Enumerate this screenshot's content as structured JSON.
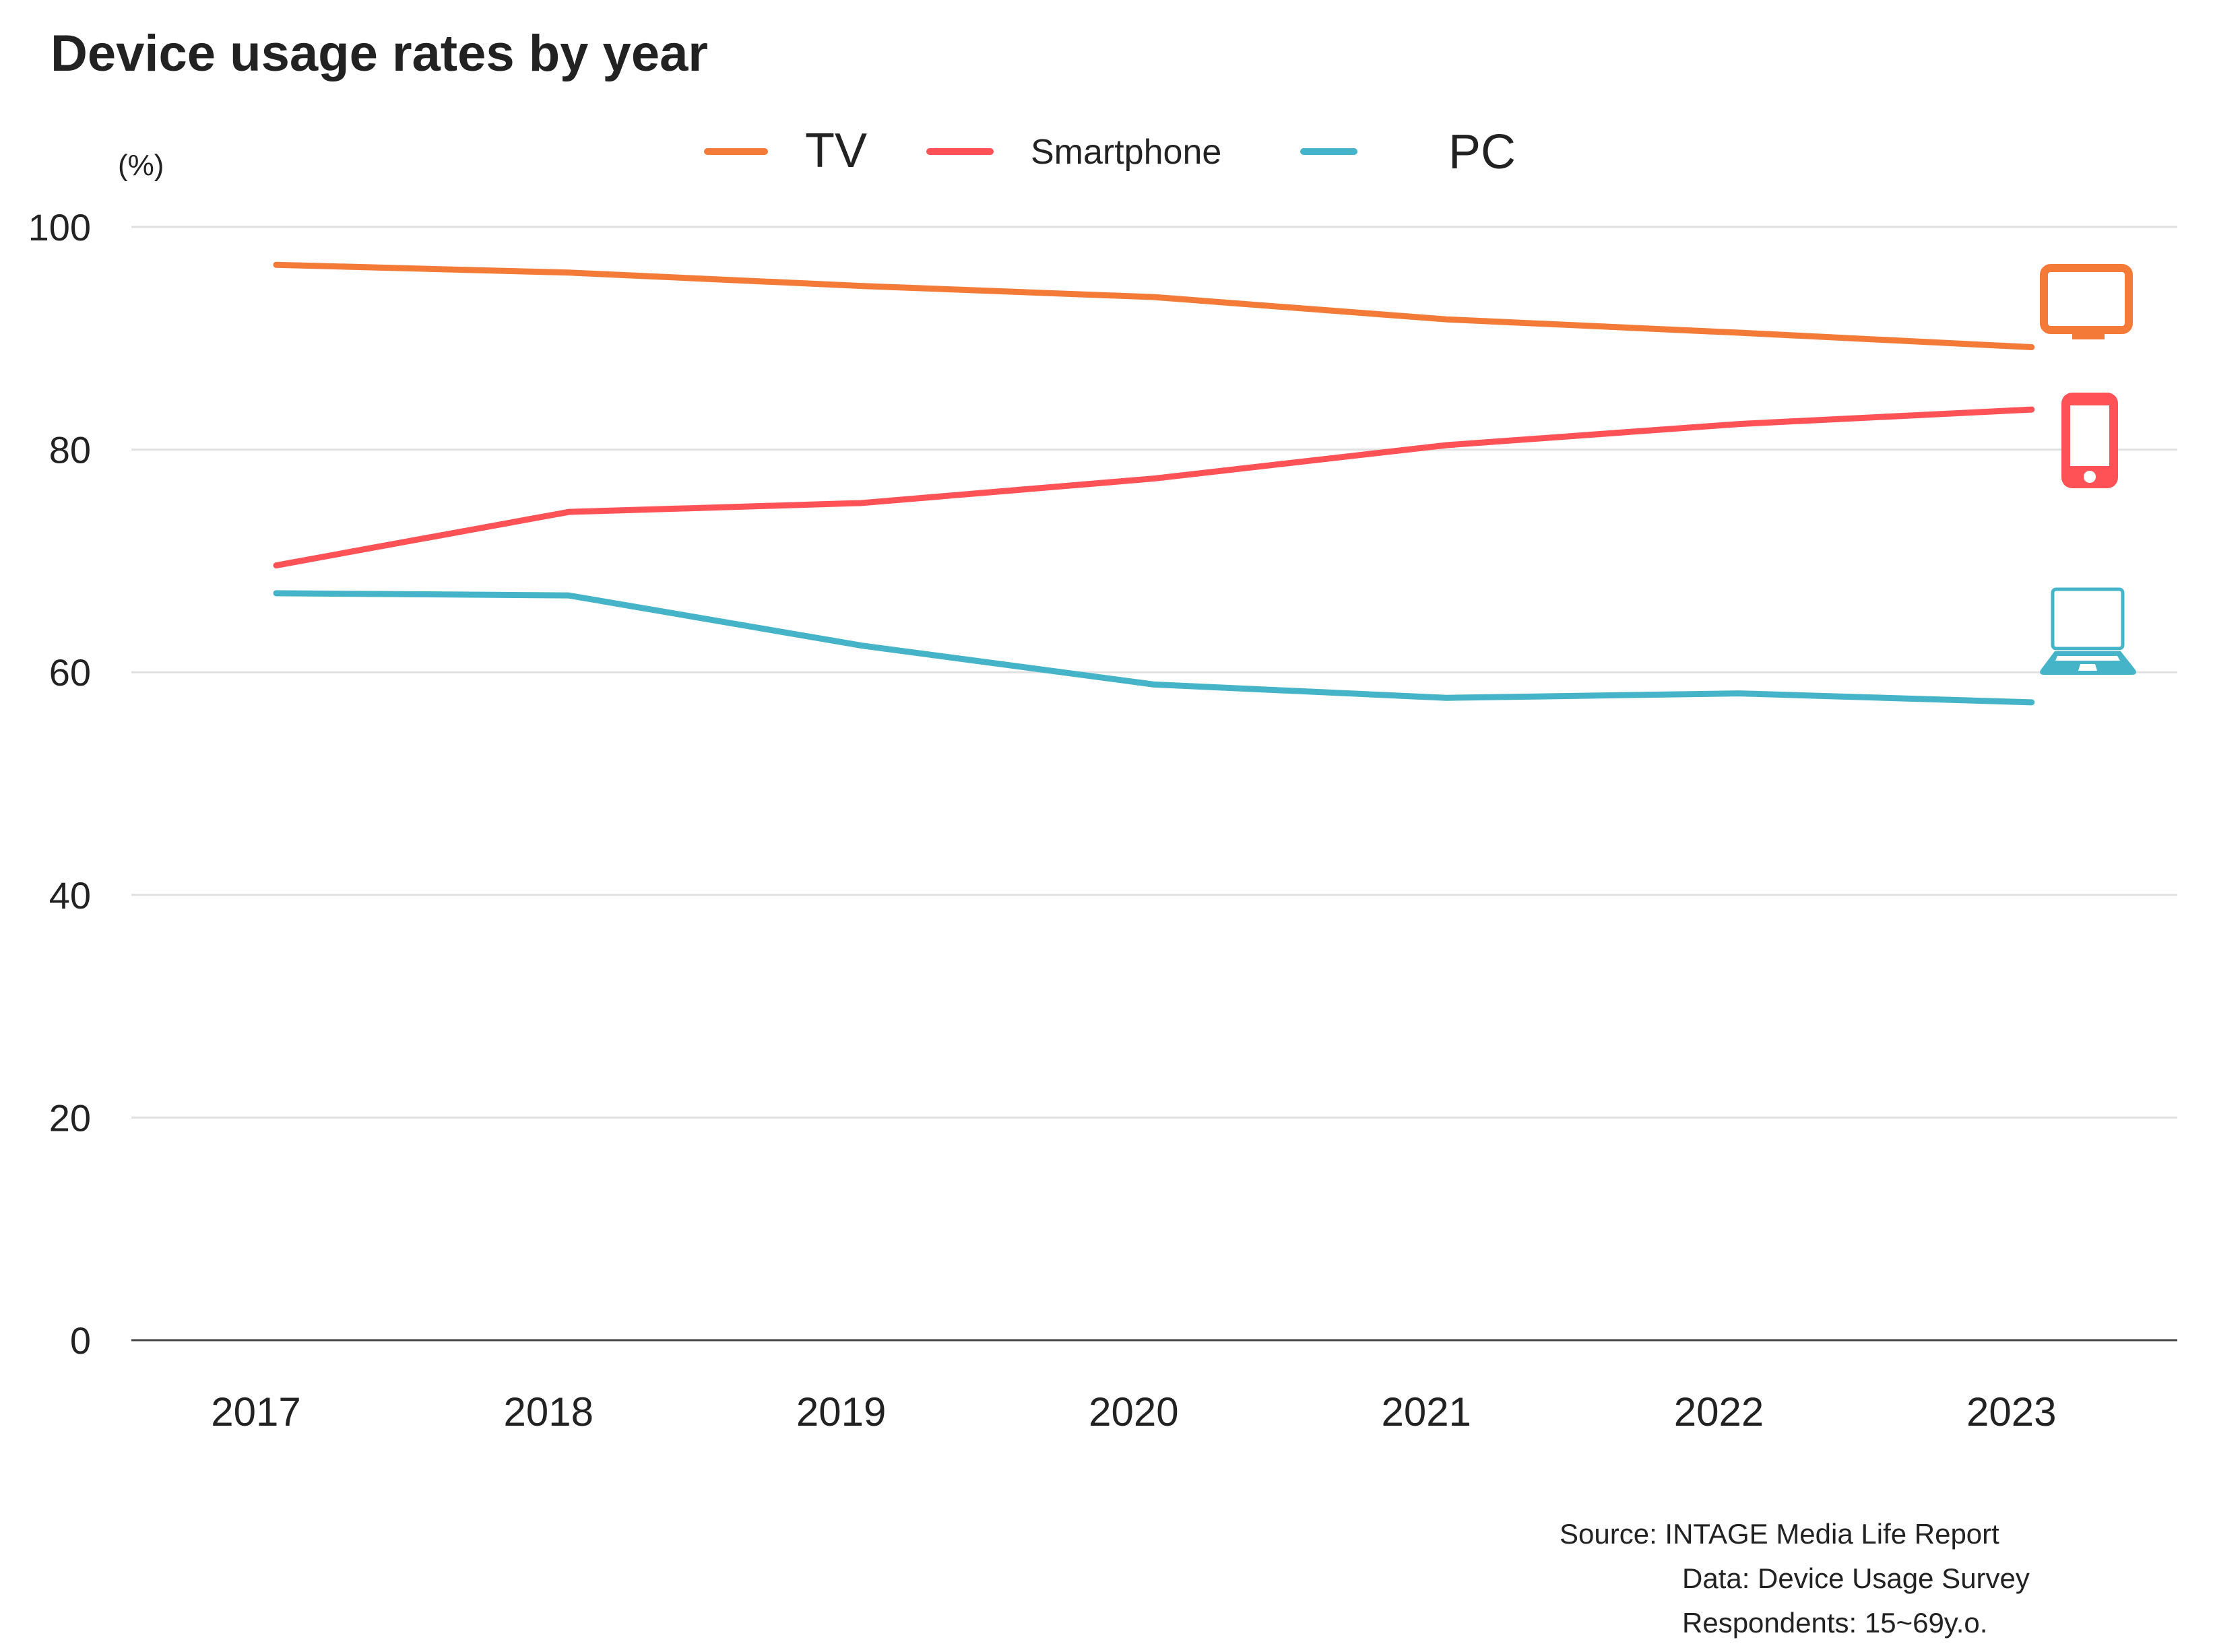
{
  "chart_data": {
    "type": "line",
    "title": "Device usage rates by year",
    "ylabel": "(%)",
    "xlabel": "",
    "x": [
      "2017",
      "2018",
      "2019",
      "2020",
      "2021",
      "2022",
      "2023"
    ],
    "ylim": [
      0,
      100
    ],
    "yticks": [
      0,
      20,
      40,
      60,
      80,
      100
    ],
    "grid": true,
    "legend_position": "top-center",
    "series": [
      {
        "name": "TV",
        "color": "#F47A38",
        "icon": "tv-icon",
        "values": [
          96.6,
          95.9,
          94.7,
          93.7,
          91.7,
          90.5,
          89.2
        ]
      },
      {
        "name": "Smartphone",
        "color": "#FF5257",
        "icon": "smartphone-icon",
        "values": [
          69.6,
          74.4,
          75.2,
          77.4,
          80.4,
          82.3,
          83.6
        ]
      },
      {
        "name": "PC",
        "color": "#45B4C8",
        "icon": "laptop-icon",
        "values": [
          67.1,
          66.9,
          62.4,
          58.9,
          57.7,
          58.1,
          57.3
        ]
      }
    ],
    "source_lines": [
      "Source: INTAGE Media Life Report",
      "Data: Device Usage Survey",
      "Respondents: 15~69y.o."
    ]
  }
}
